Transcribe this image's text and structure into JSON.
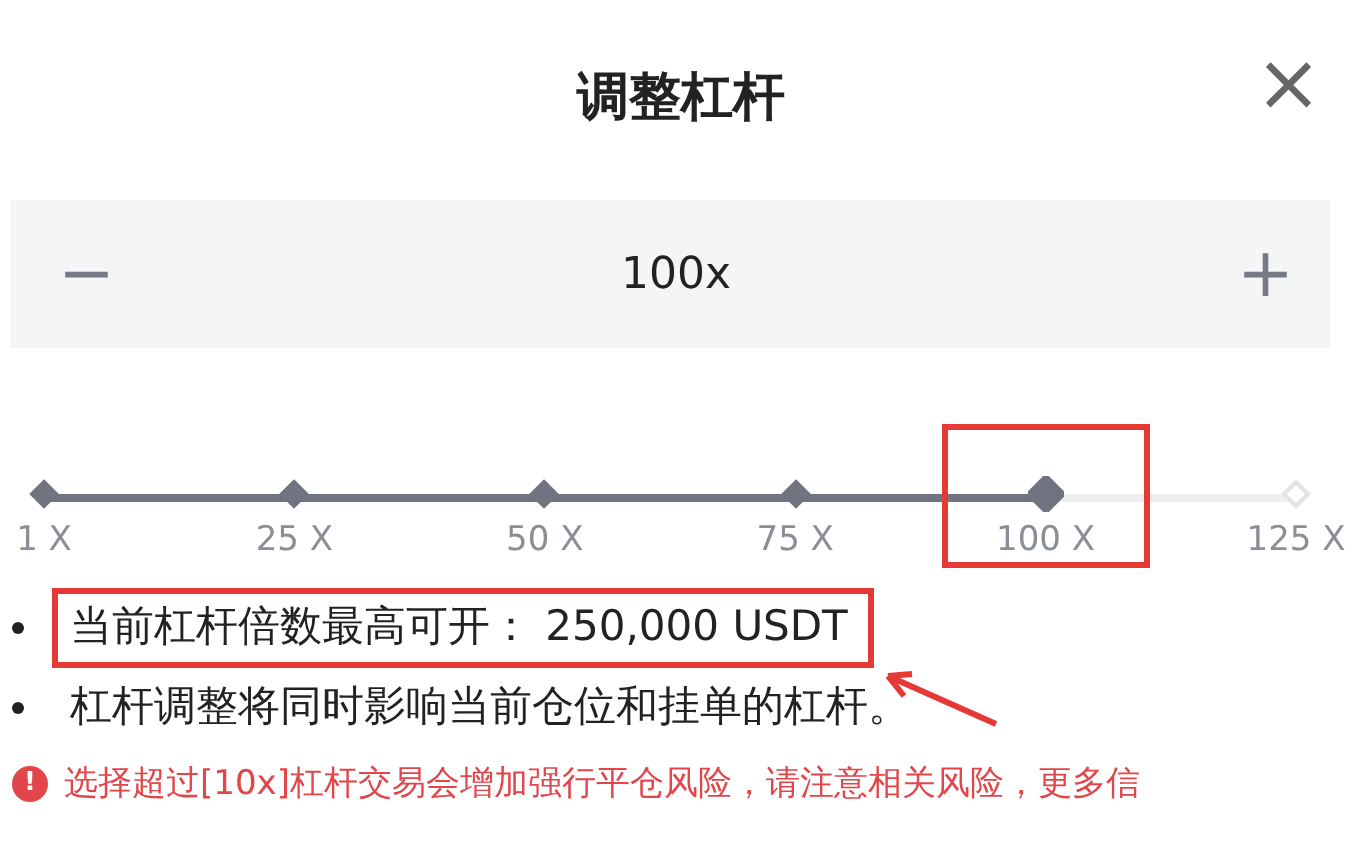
{
  "title": "调整杠杆",
  "close": "×",
  "stepper": {
    "minus": "−",
    "value": "100x",
    "plus": "+"
  },
  "slider": {
    "level": 0.8,
    "ticks": [
      {
        "label": "1 X",
        "highlighted": false
      },
      {
        "label": "25 X",
        "highlighted": false
      },
      {
        "label": "50 X",
        "highlighted": false
      },
      {
        "label": "75 X",
        "highlighted": false
      },
      {
        "label": "100 X",
        "highlighted": true
      },
      {
        "label": "125 X",
        "highlighted": false
      }
    ]
  },
  "bullets": [
    {
      "text": "当前杠杆倍数最高可开：  250,000 USDT",
      "highlighted": true
    },
    {
      "text": "杠杆调整将同时影响当前仓位和挂单的杠杆。",
      "highlighted": false
    }
  ],
  "warning": {
    "icon": "!",
    "text": "选择超过[10x]杠杆交易会增加强行平仓风险，请注意相关风险，更多信"
  }
}
